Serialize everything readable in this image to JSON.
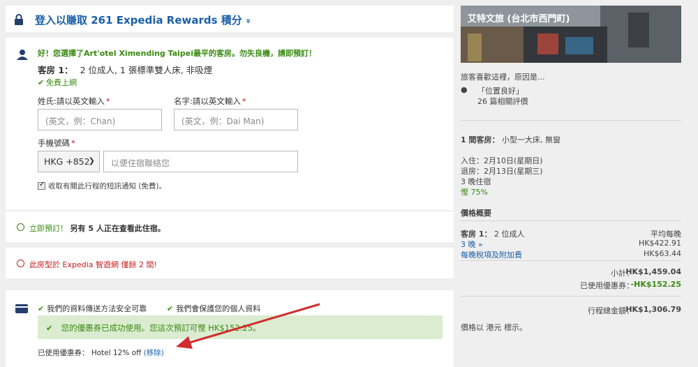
{
  "rewards": {
    "title": "登入以賺取 261 Expedia Rewards 積分",
    "chevron": "»"
  },
  "traveler": {
    "best_price_note": "好！您選擇了Art'otel Ximending Taipei最平的客房。勿失良機，請即預訂！",
    "room_label": "客房 1：",
    "room_desc": "2 位成人, 1 張標準雙人床, 非吸煙",
    "wifi": "免費上網",
    "surname_label": "姓氏:請以英文輸入",
    "surname_placeholder": "(英文，例：Chan)",
    "given_label": "名字:請以英文輸入",
    "given_placeholder": "(英文，例：Dai Man)",
    "phone_label": "手機號碼",
    "required_mark": "*",
    "country_code": "HKG +852",
    "phone_placeholder": "以便住宿聯絡您",
    "sms_label": "收取有關此行程的短訊通知 (免費)。"
  },
  "viewers": {
    "prefix": "立即預訂！",
    "bold": "另有 5 人正在查看此住宿。"
  },
  "rooms_left": {
    "text": "此房型於 Expedia 智遊網 僅餘 2 間!"
  },
  "payment": {
    "secure_1": "我們的資料傳送方法安全可靠",
    "secure_2": "我們會保護您的個人資料",
    "coupon_success": "您的優惠券已成功使用。您這次預訂可慳 HK$152.25。",
    "coupon_used_label": "已使用優惠券：",
    "coupon_name": "Hotel 12% off",
    "remove_link": "(移除)"
  },
  "sidebar": {
    "hotel_name": "艾特文旅 (台北市西門町)",
    "reason_heading": "旅客喜歡這裡，原因是...",
    "reason": "「位置良好」",
    "reviews": "26 篇相關評價",
    "room_count_label": "1 間客房：",
    "room_type": "小型一大床, 無窗",
    "checkin_label": "入住：",
    "checkin": "2月10日(星期日)",
    "checkout_label": "退房：",
    "checkout": "2月13日(星期三)",
    "nights": "3 晚住宿",
    "savings": "慳 75%",
    "price_summary": "價格概要",
    "room1_label": "客房 1：",
    "room1_guests": "2 位成人",
    "avg_label": "平均每晚",
    "nights_link": "3 晚",
    "nights_price": "HK$422.91",
    "taxes_link": "每晚稅項及附加費",
    "taxes_price": "HK$63.44",
    "subtotal_label": "小計：",
    "subtotal": "HK$1,459.04",
    "coupon_label": "已使用優惠券：",
    "coupon_amount": "-HK$152.25",
    "total_label": "行程總金額：",
    "total": "HK$1,306.79",
    "currency_note": "價格以 港元 標示。"
  }
}
